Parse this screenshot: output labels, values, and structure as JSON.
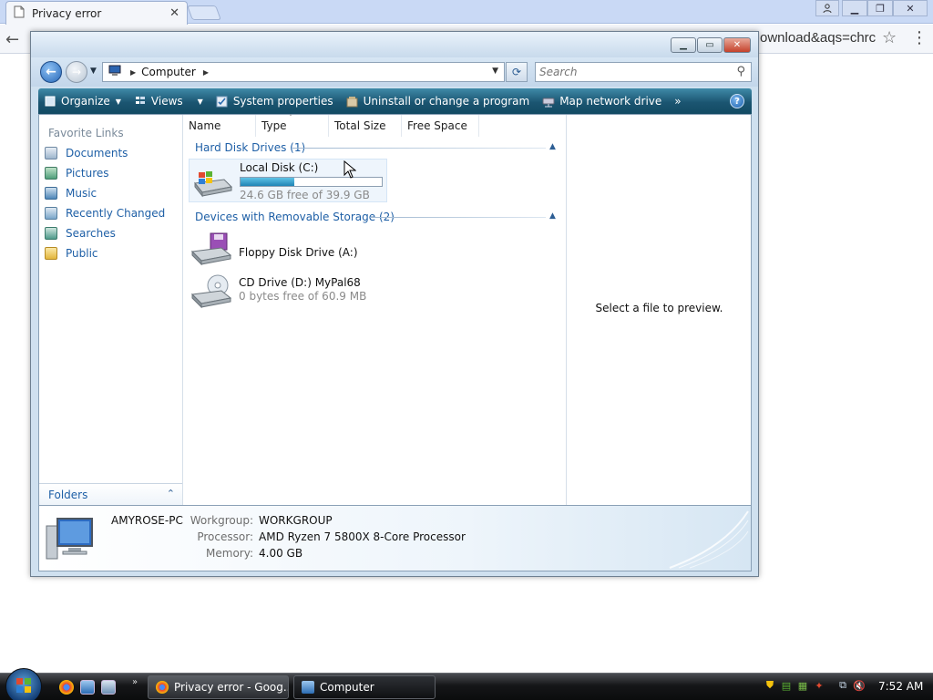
{
  "browser": {
    "tab_title": "Privacy error",
    "omnibox_visible_text": "ownload&aqs=chrc"
  },
  "explorer": {
    "breadcrumb": [
      "Computer"
    ],
    "search_placeholder": "Search",
    "commands": {
      "organize": "Organize",
      "views": "Views",
      "system_properties": "System properties",
      "uninstall": "Uninstall or change a program",
      "map_drive": "Map network drive",
      "more": "»"
    },
    "favorite_links": {
      "title": "Favorite Links",
      "items": [
        {
          "label": "Documents",
          "icon": "documents-icon"
        },
        {
          "label": "Pictures",
          "icon": "pictures-icon"
        },
        {
          "label": "Music",
          "icon": "music-icon"
        },
        {
          "label": "Recently Changed",
          "icon": "recently-changed-icon"
        },
        {
          "label": "Searches",
          "icon": "searches-icon"
        },
        {
          "label": "Public",
          "icon": "public-folder-icon"
        }
      ]
    },
    "folders_label": "Folders",
    "columns": [
      "Name",
      "Type",
      "Total Size",
      "Free Space"
    ],
    "groups": [
      {
        "label": "Hard Disk Drives (1)",
        "items": [
          {
            "name": "Local Disk (C:)",
            "detail": "24.6 GB free of 39.9 GB",
            "used_fraction": 0.38,
            "icon": "hard-disk-icon"
          }
        ]
      },
      {
        "label": "Devices with Removable Storage (2)",
        "items": [
          {
            "name": "Floppy Disk Drive (A:)",
            "detail": "",
            "icon": "floppy-drive-icon"
          },
          {
            "name": "CD Drive (D:) MyPal68",
            "detail": "0 bytes free of 60.9 MB",
            "icon": "cd-drive-icon"
          }
        ]
      }
    ],
    "preview_text": "Select a file to preview.",
    "details": {
      "pc_name": "AMYROSE-PC",
      "workgroup_label": "Workgroup:",
      "workgroup": "WORKGROUP",
      "processor_label": "Processor:",
      "processor": "AMD Ryzen 7 5800X 8-Core Processor",
      "memory_label": "Memory:",
      "memory": "4.00 GB"
    }
  },
  "taskbar": {
    "buttons": [
      {
        "label": "Privacy error - Goog...",
        "icon": "chrome-icon"
      },
      {
        "label": "Computer",
        "icon": "computer-icon"
      }
    ],
    "clock": "7:52 AM"
  },
  "colors": {
    "accent_blue": "#1e5fa6",
    "command_bar": "#1b5571",
    "disk_fill": "#1f84b5"
  }
}
